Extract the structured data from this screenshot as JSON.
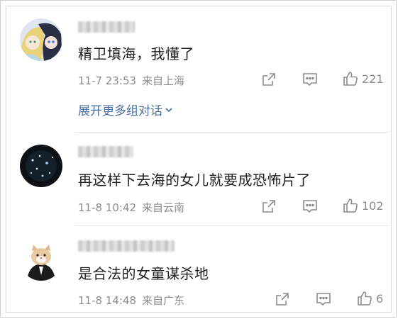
{
  "comments": [
    {
      "text": "精卫填海，我懂了",
      "time": "11-7 23:53",
      "location": "来自上海",
      "likes": "221",
      "expand_label": "展开更多组对话"
    },
    {
      "text": "再这样下去海的女儿就要成恐怖片了",
      "time": "11-8 10:42",
      "location": "来自云南",
      "likes": "102"
    },
    {
      "text": "是合法的女童谋杀地",
      "time": "11-8 14:48",
      "location": "来自广东",
      "likes": "6"
    }
  ],
  "icons": {
    "share": "share-icon",
    "reply": "comment-icon",
    "like": "thumbs-up-icon",
    "expand": "chevron-down-icon"
  },
  "colors": {
    "text": "#1f1f1f",
    "meta": "#8c8c8c",
    "link": "#4a6fa6"
  }
}
